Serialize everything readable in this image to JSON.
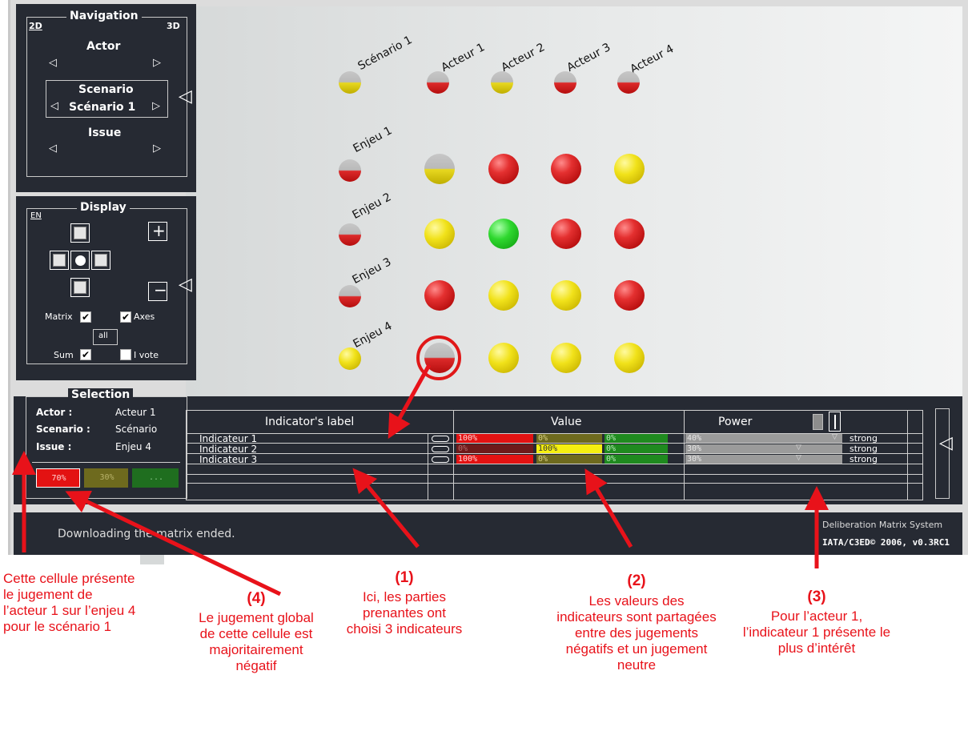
{
  "navigation": {
    "title": "Navigation",
    "mode_2d": "2D",
    "mode_3d": "3D",
    "actor_label": "Actor",
    "scenario_label": "Scenario",
    "scenario_value": "Scénario 1",
    "issue_label": "Issue"
  },
  "display": {
    "title": "Display",
    "lang": "EN",
    "matrix_label": "Matrix",
    "axes_label": "Axes",
    "all_label": "all",
    "sum_label": "Sum",
    "ivote_label": "I vote",
    "matrix_checked": "✔",
    "axes_checked": "✔",
    "sum_checked": "✔"
  },
  "matrix": {
    "scenario_header": "Scénario 1",
    "actors": [
      "Acteur 1",
      "Acteur 2",
      "Acteur 3",
      "Acteur 4"
    ],
    "issues": [
      "Enjeu 1",
      "Enjeu 2",
      "Enjeu 3",
      "Enjeu 4"
    ],
    "cells": [
      [
        "half-yel",
        "red",
        "red",
        "yel"
      ],
      [
        "yel",
        "grn",
        "red",
        "red"
      ],
      [
        "red",
        "yel",
        "yel",
        "red"
      ],
      [
        "half-red-big",
        "yel",
        "yel",
        "yel"
      ]
    ],
    "actor_sums": [
      "half-red",
      "half-yel",
      "half-red",
      "half-red"
    ],
    "issue_sums": [
      "half-red",
      "half-red",
      "half-red",
      "yel"
    ],
    "scenario_sum": "half-yel",
    "colors": {
      "negative": "#e02020",
      "neutral": "#efe01a",
      "positive": "#22c022"
    }
  },
  "selection": {
    "title": "Selection",
    "actor_key": "Actor :",
    "actor_val": "Acteur 1",
    "scenario_key": "Scenario :",
    "scenario_val": "Scénario",
    "issue_key": "Issue :",
    "issue_val": "Enjeu 4",
    "neg": "70%",
    "neu": "30%",
    "pos": "..."
  },
  "table": {
    "col_label": "Indicator's label",
    "col_value": "Value",
    "col_power": "Power",
    "rows": [
      {
        "label": "Indicateur 1",
        "neg": "100%",
        "neu": "0%",
        "pos": "0%",
        "neg_v": 1.0,
        "neu_v": 0.0,
        "power": "40%",
        "power_v": 0.4,
        "strength": "strong"
      },
      {
        "label": "Indicateur 2",
        "neg": "0%",
        "neu": "100%",
        "pos": "0%",
        "neg_v": 0.0,
        "neu_v": 1.0,
        "power": "30%",
        "power_v": 0.3,
        "strength": "strong"
      },
      {
        "label": "Indicateur 3",
        "neg": "100%",
        "neu": "0%",
        "pos": "0%",
        "neg_v": 1.0,
        "neu_v": 0.0,
        "power": "30%",
        "power_v": 0.3,
        "strength": "strong"
      }
    ]
  },
  "status": {
    "message": "Downloading the matrix ended.",
    "product": "Deliberation Matrix System",
    "copyright": "IATA/C3ED© 2006, v0.3RC1"
  },
  "annotations": {
    "a0": "Cette cellule présente le jugement de l’acteur 1 sur l’enjeu 4 pour le scénario 1",
    "a4_num": "(4)",
    "a4": "Le jugement global de cette cellule est majoritairement négatif",
    "a1_num": "(1)",
    "a1": "Ici, les parties prenantes ont choisi 3 indicateurs",
    "a2_num": "(2)",
    "a2": "Les valeurs des indicateurs sont partagées entre des jugements négatifs et un jugement neutre",
    "a3_num": "(3)",
    "a3": "Pour l’acteur 1, l’indicateur 1 présente le plus d’intérêt"
  }
}
